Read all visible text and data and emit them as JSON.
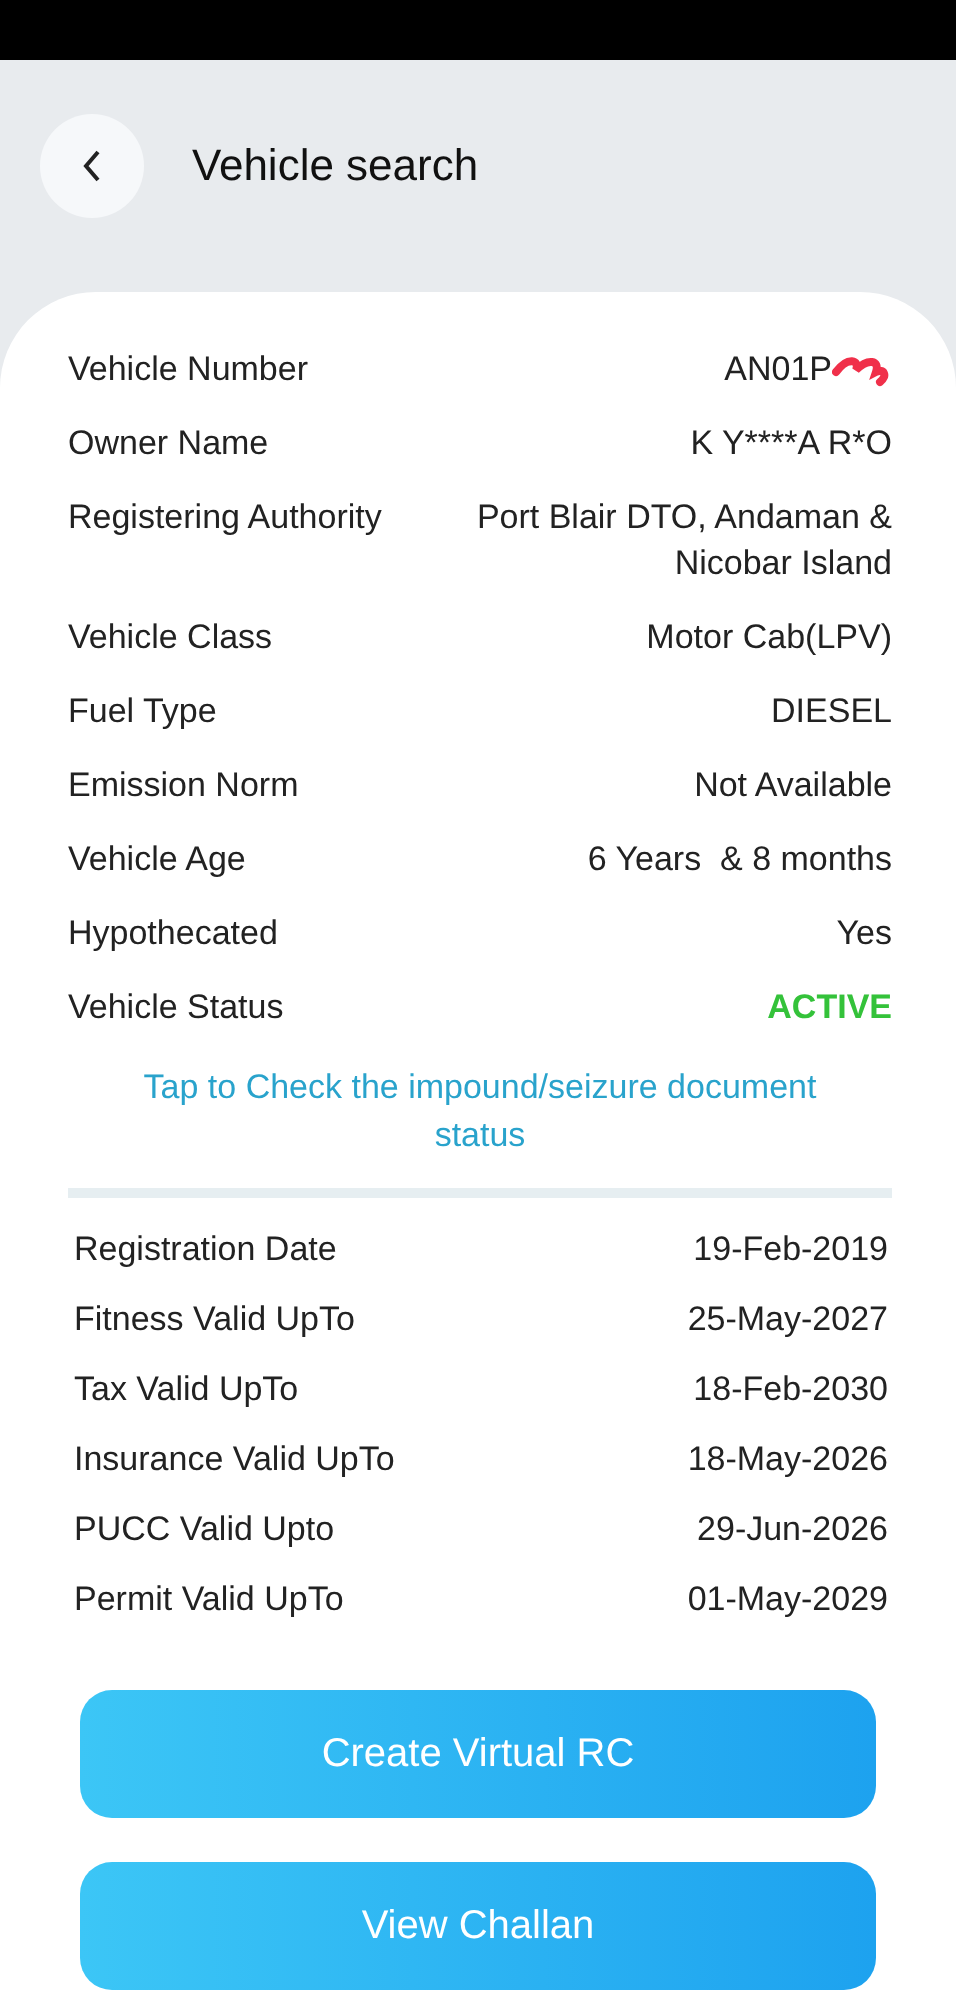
{
  "header": {
    "title": "Vehicle search"
  },
  "details": [
    {
      "kind": "redacted",
      "label": "Vehicle Number",
      "value": "AN01P"
    },
    {
      "kind": "text",
      "label": "Owner Name",
      "value": "K Y****A R*O"
    },
    {
      "kind": "text",
      "label": "Registering Authority",
      "value": "Port Blair DTO, Andaman & Nicobar Island"
    },
    {
      "kind": "text",
      "label": "Vehicle Class",
      "value": "Motor Cab(LPV)"
    },
    {
      "kind": "text",
      "label": "Fuel Type",
      "value": "DIESEL"
    },
    {
      "kind": "text",
      "label": "Emission Norm",
      "value": "Not Available"
    },
    {
      "kind": "text",
      "label": "Vehicle Age",
      "value": "6 Years  & 8 months"
    },
    {
      "kind": "text",
      "label": "Hypothecated",
      "value": "Yes"
    },
    {
      "kind": "status",
      "label": "Vehicle Status",
      "value": "ACTIVE"
    }
  ],
  "impound_link": "Tap to Check the impound/seizure document status",
  "validity": [
    {
      "label": "Registration Date",
      "value": "19-Feb-2019"
    },
    {
      "label": "Fitness Valid UpTo",
      "value": "25-May-2027"
    },
    {
      "label": "Tax Valid UpTo",
      "value": "18-Feb-2030"
    },
    {
      "label": "Insurance Valid UpTo",
      "value": "18-May-2026"
    },
    {
      "label": "PUCC Valid Upto",
      "value": "29-Jun-2026"
    },
    {
      "label": "Permit Valid UpTo",
      "value": "01-May-2029"
    }
  ],
  "buttons": [
    "Create Virtual RC",
    "View Challan"
  ]
}
